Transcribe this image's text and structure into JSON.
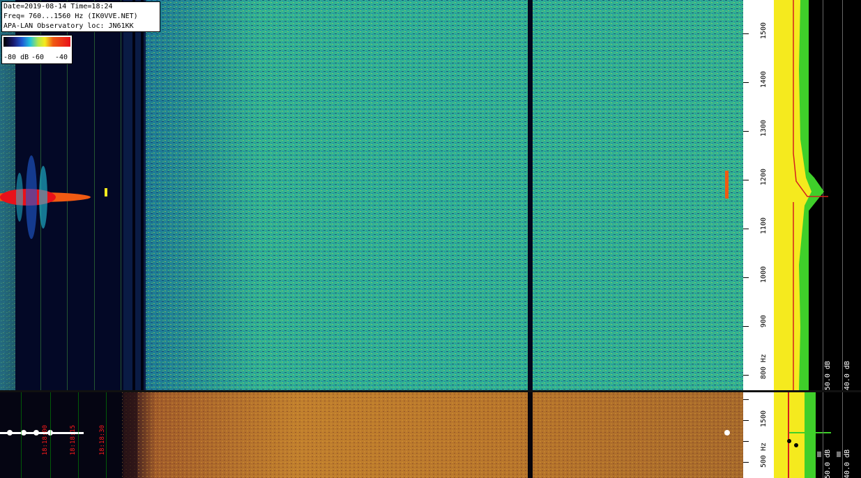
{
  "header": {
    "line1": "Date=2019-08-14 Time=18:24",
    "line2": "Freq= 760...1560 Hz (IK0VVE.NET)",
    "line3": "APA-LAN Observatory loc: JN61KK"
  },
  "color_scale": {
    "labels": [
      "-80 dB",
      "-60",
      "-40"
    ]
  },
  "freq_axis": {
    "top_ticks": [
      "1500",
      "1400",
      "1300",
      "1200",
      "1100",
      "1000",
      "900",
      "800 Hz"
    ],
    "bottom_ticks": [
      "1500",
      "500 Hz"
    ]
  },
  "spectrum_labels": {
    "top": [
      "-50.0 dB",
      "-40.0 dB"
    ],
    "bottom": [
      "-50.0 dB",
      "-40.0 dB"
    ]
  },
  "time_axis": {
    "labels": [
      "18:18:00",
      "18:18:15",
      "18:18:30"
    ]
  },
  "colors": {
    "waterfall_signal": "#e8111a",
    "spectrum_avg": "#f5ea1e",
    "spectrum_peak": "#3fcf2a",
    "trace": "#d41e1e"
  }
}
